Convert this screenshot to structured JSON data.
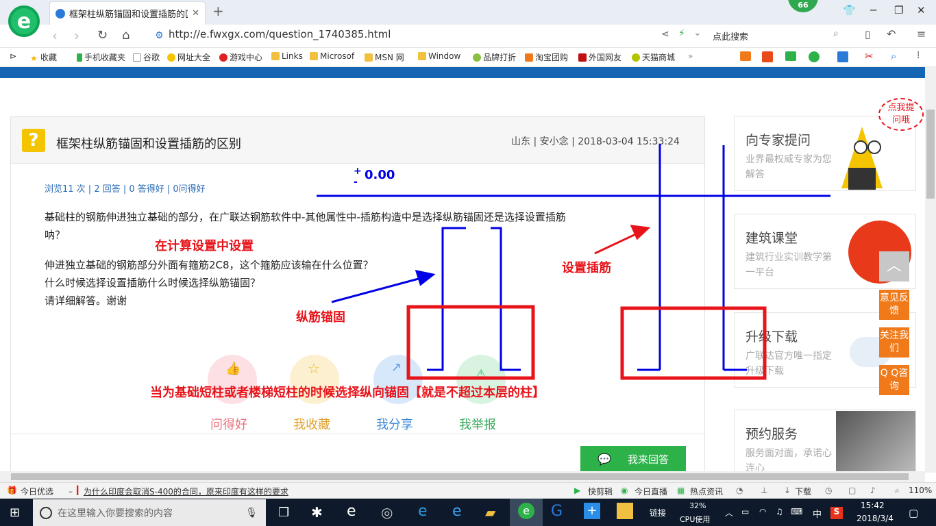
{
  "browser": {
    "tab_title": "框架柱纵筋锚固和设置插筋的区别",
    "badge_count": "66",
    "url": "http://e.fwxgx.com/question_1740385.html",
    "search_placeholder": "点此搜索"
  },
  "bookmarks": [
    "收藏",
    "手机收藏夹",
    "谷歌",
    "网址大全",
    "游戏中心",
    "Links",
    "Microsof",
    "MSN 网",
    "Window",
    "品牌打折",
    "淘宝团购",
    "外国网友",
    "天猫商城"
  ],
  "question": {
    "title": "框架柱纵筋锚固和设置插筋的区别",
    "meta": "山东 | 安小念 | 2018-03-04 15:33:24",
    "stats": "浏览11 次 | 2 回答 | 0 答得好 | 0问得好",
    "body_line1": "基础柱的钢筋伸进独立基础的部分，在广联达钢筋软件中-其他属性中-插筋构造中是选择纵筋锚固还是选择设置插筋",
    "body_line2": "呐？",
    "body_line3": "伸进独立基础的钢筋部分外面有箍筋2C8，这个箍筋应该输在什么位置？",
    "body_line4": "什么时候选择设置插筋什么时候选择纵筋锚固？",
    "body_line5": "请详细解答。谢谢"
  },
  "actions": {
    "good": "问得好",
    "collect": "我收藏",
    "share": "我分享",
    "report": "我举报",
    "answer": "我来回答"
  },
  "annotations": {
    "level": "0.00",
    "plus": "+",
    "minus": "-",
    "calc_setting": "在计算设置中设置",
    "set_insert": "设置插筋",
    "anchor": "纵筋锚固",
    "note": "当为基础短柱或者楼梯短柱的时候选择纵向锚固【就是不超过本层的柱】"
  },
  "sidebar": {
    "ask_title": "向专家提问",
    "ask_sub": "业界最权威专家为您解答",
    "bubble": "点我提问哦",
    "class_title": "建筑课堂",
    "class_sub": "建筑行业实训教学第一平台",
    "upgrade_title": "升级下载",
    "upgrade_sub": "广联达官方唯一指定升级下载",
    "booking_title": "预约服务",
    "booking_sub": "服务面对面，承诺心连心",
    "feedback": "意见反馈",
    "follow": "关注我们",
    "qq": "Q Q咨询"
  },
  "statusbar": {
    "today": "今日优选",
    "news": "为什么印度会取消S-400的合同，原来印度有这样的要求",
    "clip": "快剪辑",
    "live": "今日直播",
    "hot": "热点资讯",
    "download": "下载",
    "zoom": "110%"
  },
  "taskbar": {
    "search": "在这里输入你要搜索的内容",
    "link": "链接",
    "cpu": "32%",
    "cpu_label": "CPU使用",
    "ime": "中",
    "time": "15:42",
    "date": "2018/3/4"
  },
  "colors": {
    "accent": "#1565b5",
    "green": "#2db24a",
    "annot_red": "#e8141b",
    "annot_blue": "#0000e6"
  }
}
